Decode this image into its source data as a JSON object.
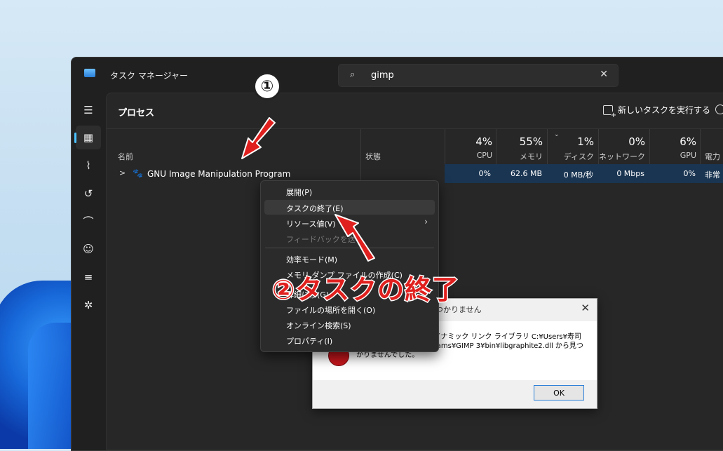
{
  "window": {
    "title": "タスク マネージャー"
  },
  "search": {
    "value": "gimp"
  },
  "sidebar": {
    "items": [
      {
        "name": "menu-icon",
        "glyph": "☰"
      },
      {
        "name": "processes-icon",
        "glyph": "▦"
      },
      {
        "name": "performance-icon",
        "glyph": "⌇"
      },
      {
        "name": "app-history-icon",
        "glyph": "↺"
      },
      {
        "name": "startup-apps-icon",
        "glyph": "⌒"
      },
      {
        "name": "users-icon",
        "glyph": "☺"
      },
      {
        "name": "details-icon",
        "glyph": "≡"
      },
      {
        "name": "services-icon",
        "glyph": "✲"
      }
    ]
  },
  "page": {
    "title": "プロセス",
    "run_task_label": "新しいタスクを実行する"
  },
  "columns": {
    "name": "名前",
    "status": "状態",
    "cpu": {
      "pct": "4%",
      "label": "CPU"
    },
    "memory": {
      "pct": "55%",
      "label": "メモリ"
    },
    "disk": {
      "pct": "1%",
      "label": "ディスク"
    },
    "network": {
      "pct": "0%",
      "label": "ネットワーク"
    },
    "gpu": {
      "pct": "6%",
      "label": "GPU"
    },
    "power": {
      "label": "電力"
    }
  },
  "process": {
    "name": "GNU Image Manipulation Program",
    "cpu": "0%",
    "memory": "62.6 MB",
    "disk": "0 MB/秒",
    "network": "0 Mbps",
    "gpu": "0%",
    "power": "非常"
  },
  "context_menu": {
    "items": [
      {
        "label": "展開(P)"
      },
      {
        "label": "タスクの終了(E)"
      },
      {
        "label": "リソース値(V)"
      },
      {
        "label": "フィードバックを送"
      },
      {
        "label": "効率モード(M)"
      },
      {
        "label": "メモリ ダンプ ファイルの作成(C)"
      },
      {
        "label": "詳細に移(G)"
      },
      {
        "label": "ファイルの場所を開く(O)"
      },
      {
        "label": "オンライン検索(S)"
      },
      {
        "label": "プロパティ(I)"
      }
    ]
  },
  "dialog": {
    "title": "つかりません",
    "message": "_Unwind_Resume がダイナミック リンク ライブラリ C:¥Users¥寿司¥AppData¥Local¥Programs¥GIMP 3¥bin¥libgraphite2.dll から見つかりませんでした。",
    "ok_label": "OK"
  },
  "annotations": {
    "step1": "①",
    "step2": "②タスクの終了",
    "arrow_color": "#e0201e"
  }
}
